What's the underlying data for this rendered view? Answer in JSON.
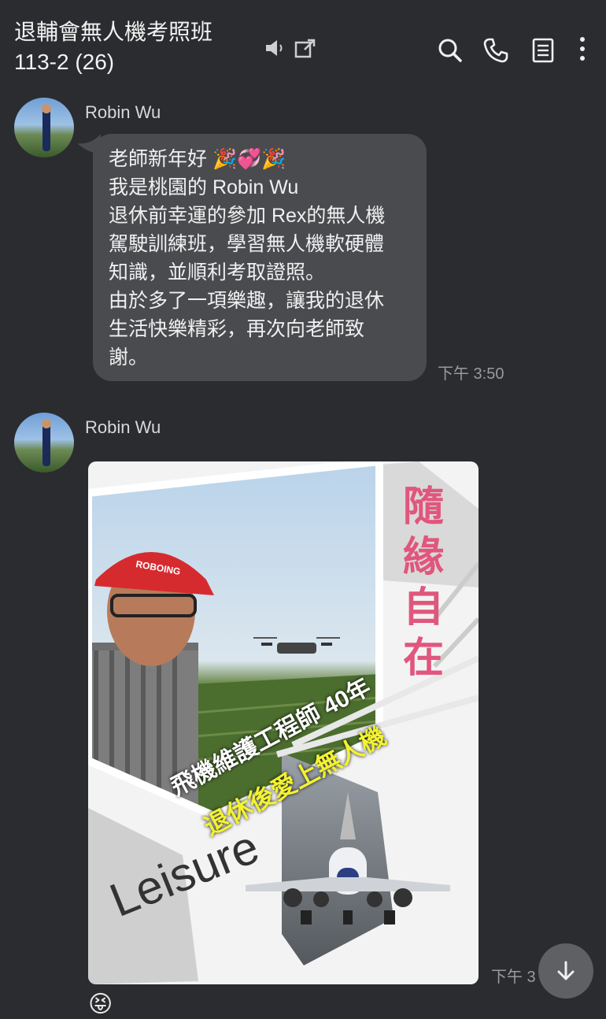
{
  "header": {
    "title_line1": "退輔會無人機考照班",
    "title_line2": "113-2 (26)"
  },
  "messages": [
    {
      "sender": "Robin Wu",
      "lines": [
        "老師新年好 🎉💞🎉",
        "我是桃園的 Robin Wu",
        "退休前幸運的參加 Rex的無人機",
        "駕駛訓練班，學習無人機軟硬體",
        "知識，並順利考取證照。",
        "由於多了一項樂趣，讓我的退休",
        "生活快樂精彩，再次向老師致",
        "謝。"
      ],
      "time": "下午 3:50"
    },
    {
      "sender": "Robin Wu",
      "image": {
        "vertical_text": [
          "隨",
          "緣",
          "自",
          "在"
        ],
        "caption1": "飛機維護工程師 40年",
        "caption2": "退休後愛上無人機",
        "leisure": "Leisure",
        "cap_text": "ROBOING",
        "colors": {
          "accent": "#e0567c",
          "caption2": "#f2f230"
        }
      },
      "time": "下午 3"
    }
  ],
  "sticker": "😝",
  "colors": {
    "background": "#2b2c2f",
    "bubble": "#4a4b4f"
  }
}
